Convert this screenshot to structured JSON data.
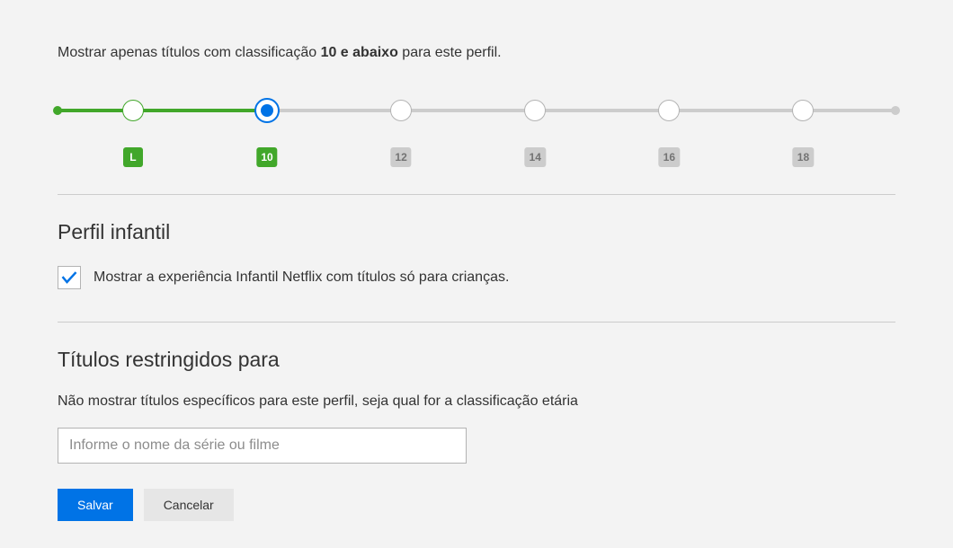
{
  "intro": {
    "prefix": "Mostrar apenas títulos com classificação ",
    "bold": "10 e abaixo",
    "suffix": " para este perfil."
  },
  "slider": {
    "selected_index": 1,
    "positions_pct": [
      9,
      25,
      41,
      57,
      73,
      89
    ],
    "fill_pct": 25,
    "labels": [
      "L",
      "10",
      "12",
      "14",
      "16",
      "18"
    ]
  },
  "kids_section": {
    "title": "Perfil infantil",
    "checkbox_checked": true,
    "checkbox_label": "Mostrar a experiência Infantil Netflix com títulos só para crianças."
  },
  "restrict_section": {
    "title": "Títulos restringidos para",
    "subtitle": "Não mostrar títulos específicos para este perfil, seja qual for a classificação etária",
    "input_placeholder": "Informe o nome da série ou filme"
  },
  "buttons": {
    "save": "Salvar",
    "cancel": "Cancelar"
  }
}
